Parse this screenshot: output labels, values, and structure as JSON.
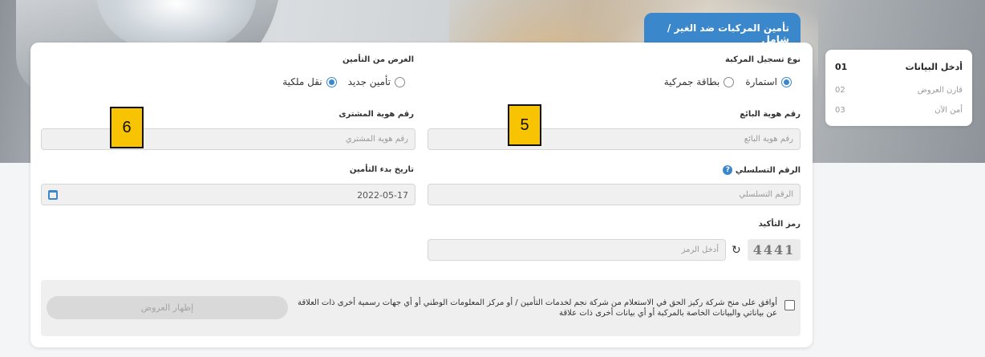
{
  "tab": {
    "title": "تأمين المركبات ضد الغير / شامل"
  },
  "steps": [
    {
      "num": "01",
      "label": "أدخل البيانات"
    },
    {
      "num": "02",
      "label": "قارن العروض"
    },
    {
      "num": "03",
      "label": "أمن الآن"
    }
  ],
  "form": {
    "registration_type": {
      "label": "نوع تسجيل المركبة",
      "options": [
        {
          "label": "استمارة",
          "selected": true
        },
        {
          "label": "بطاقة جمركية",
          "selected": false
        }
      ]
    },
    "insurance_purpose": {
      "label": "الغرض من التأمين",
      "options": [
        {
          "label": "تأمين جديد",
          "selected": false
        },
        {
          "label": "نقل ملكية",
          "selected": true
        }
      ]
    },
    "seller_id": {
      "label": "رقم هوية البائع",
      "placeholder": "رقم هوية البائع"
    },
    "buyer_id": {
      "label": "رقم هوية المشترى",
      "placeholder": "رقم هوية المشتري"
    },
    "serial_number": {
      "label": "الرقم التسلسلي",
      "placeholder": "الرقم التسلسلي",
      "help_icon": "?"
    },
    "start_date": {
      "label": "تاريخ بدء التأمين",
      "value": "2022-05-17"
    },
    "captcha": {
      "label": "رمز التأكيد",
      "placeholder": "أدخل الرمز",
      "image_text": "4441"
    }
  },
  "markers": {
    "m5": "5",
    "m6": "6"
  },
  "consent": {
    "text": "أوافق على منح شركة ركيز الحق في الاستعلام من شركة نجم لخدمات التأمين / أو مركز المعلومات الوطني أو أي جهات رسمية أخرى ذات العلاقة عن بياناتي والبيانات الخاصة بالمركبة أو أي بيانات أخرى ذات علاقة",
    "button": "إظهار العروض"
  },
  "colors": {
    "accent": "#3b87cc",
    "marker": "#f8c300"
  }
}
